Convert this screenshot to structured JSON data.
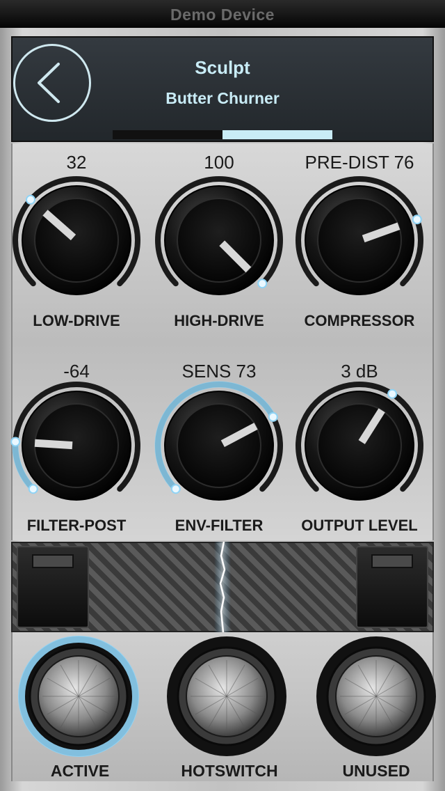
{
  "status_bar": {
    "device_name": "Demo Device"
  },
  "header": {
    "title": "Sculpt",
    "subtitle": "Butter Churner",
    "page_count": 2,
    "active_page": 2,
    "accent_color": "#c9ecf6"
  },
  "knobs": [
    {
      "id": "low-drive",
      "label": "LOW-DRIVE",
      "value": "32",
      "level": 0.32,
      "led": false
    },
    {
      "id": "high-drive",
      "label": "HIGH-DRIVE",
      "value": "100",
      "level": 1.0,
      "led": false
    },
    {
      "id": "compressor",
      "label": "COMPRESSOR",
      "value": "PRE-DIST 76",
      "level": 0.76,
      "led": false
    },
    {
      "id": "filter-post",
      "label": "FILTER-POST",
      "value": "-64",
      "level": 0.18,
      "led": true
    },
    {
      "id": "env-filter",
      "label": "ENV-FILTER",
      "value": "SENS  73",
      "level": 0.73,
      "led": true
    },
    {
      "id": "output-level",
      "label": "OUTPUT LEVEL",
      "value": "3 dB",
      "level": 0.62,
      "led": false
    }
  ],
  "footswitches": [
    {
      "id": "active",
      "label": "ACTIVE",
      "lit": true
    },
    {
      "id": "hotswitch",
      "label": "HOTSWITCH",
      "lit": false
    },
    {
      "id": "unused",
      "label": "UNUSED",
      "lit": false
    }
  ],
  "colors": {
    "led_blue": "#8fd3f5",
    "knob_dark": "#0b0b0b"
  }
}
